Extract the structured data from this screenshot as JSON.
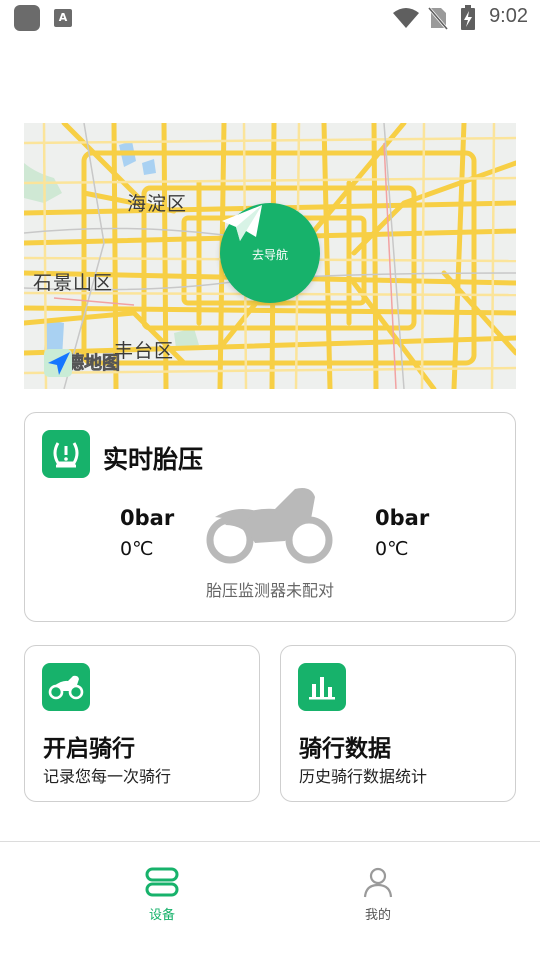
{
  "status_bar": {
    "time": "9:02",
    "a_icon_letter": "A"
  },
  "map": {
    "districts": [
      "海淀区",
      "石景山区",
      "丰台区"
    ],
    "nav_button_label": "去导航",
    "provider_logo": "高德地图"
  },
  "tire_pressure": {
    "title": "实时胎压",
    "front": {
      "pressure": "0bar",
      "temperature": "0℃"
    },
    "rear": {
      "pressure": "0bar",
      "temperature": "0℃"
    },
    "status": "胎压监测器未配对"
  },
  "features": [
    {
      "title": "开启骑行",
      "subtitle": "记录您每一次骑行",
      "icon": "motorcycle-icon"
    },
    {
      "title": "骑行数据",
      "subtitle": "历史骑行数据统计",
      "icon": "bar-chart-icon"
    }
  ],
  "bottom_nav": [
    {
      "label": "设备",
      "icon": "device-icon",
      "active": true
    },
    {
      "label": "我的",
      "icon": "user-icon",
      "active": false
    }
  ],
  "colors": {
    "accent": "#17b26b",
    "map_road": "#f7cf45",
    "inactive": "#9a9a9a"
  }
}
